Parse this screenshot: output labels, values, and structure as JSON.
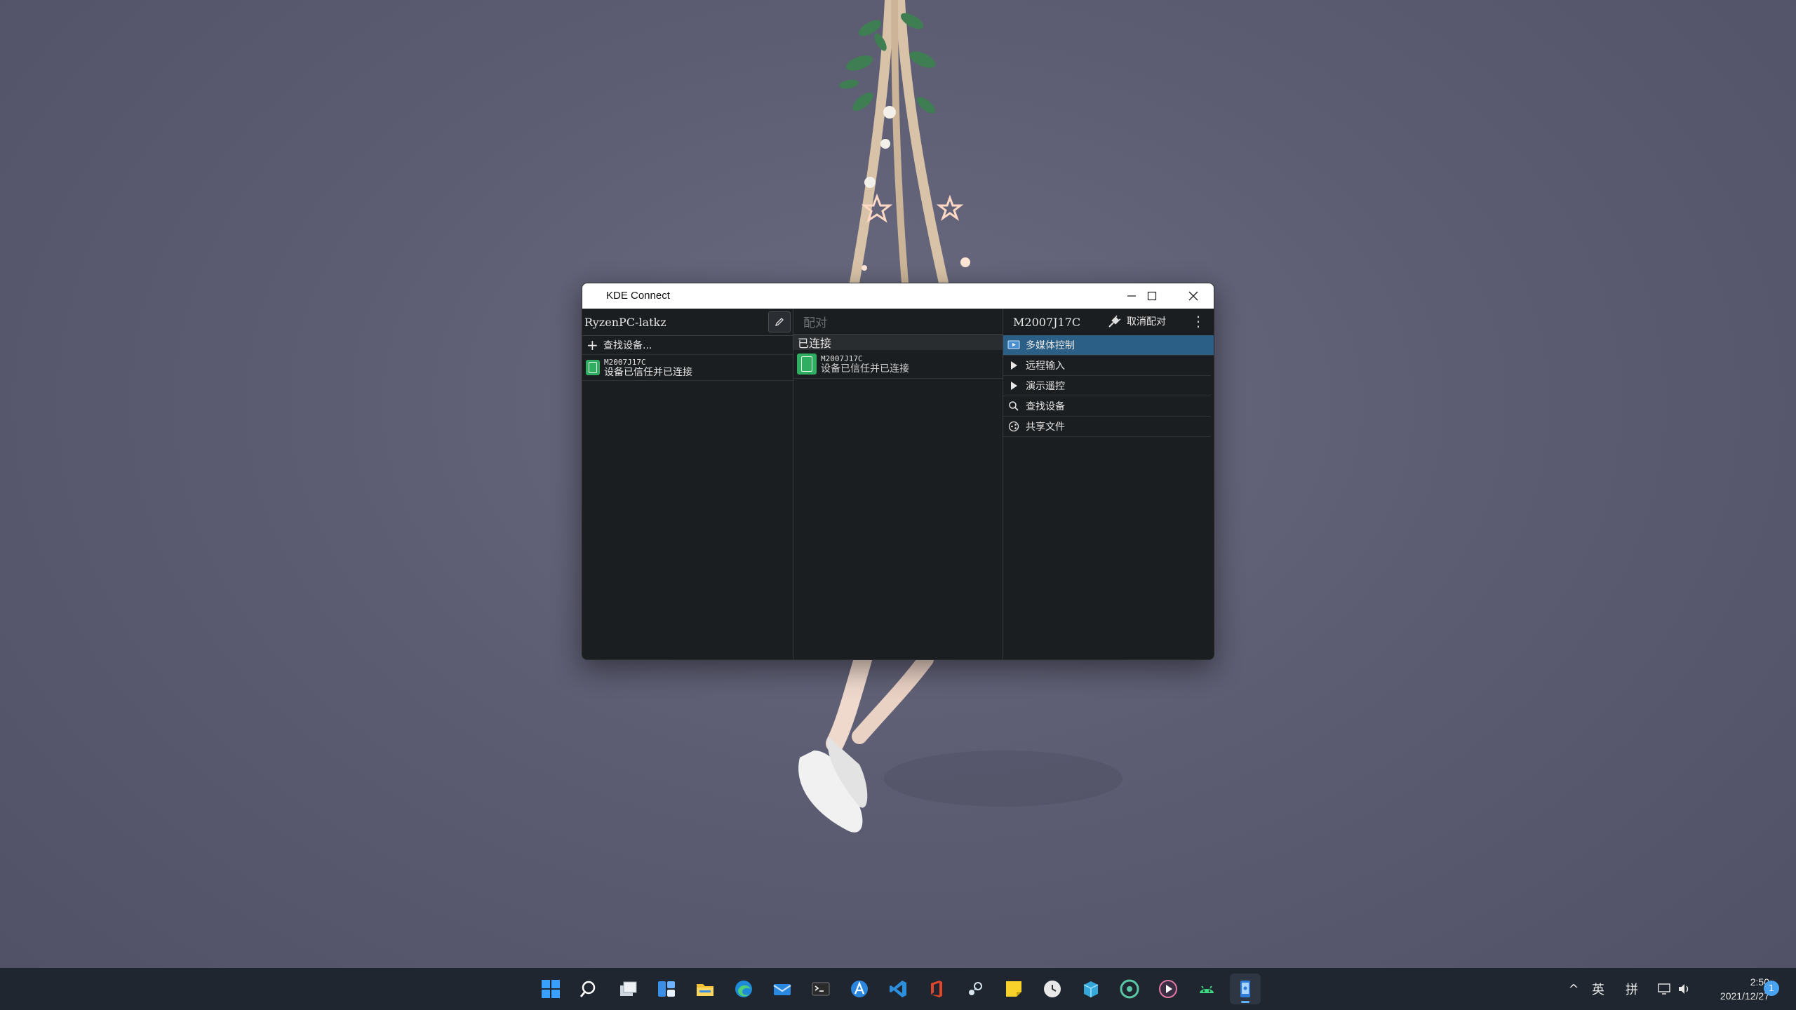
{
  "window": {
    "title": "KDE Connect",
    "controls": {
      "minimize": "minimize",
      "maximize": "maximize",
      "close": "close"
    }
  },
  "left_pane": {
    "host_name": "RyzenPC-latkz",
    "find_devices_label": "查找设备...",
    "devices": [
      {
        "name": "M2007J17C",
        "status": "设备已信任并已连接"
      }
    ]
  },
  "middle_pane": {
    "pair_label": "配对",
    "section_title": "已连接",
    "devices": [
      {
        "name": "M2007J17C",
        "status": "设备已信任并已连接"
      }
    ]
  },
  "right_pane": {
    "device_title": "M2007J17C",
    "unpair_label": "取消配对",
    "plugins": [
      {
        "label": "多媒体控制",
        "icon": "media-control-icon",
        "selected": true
      },
      {
        "label": "远程输入",
        "icon": "pointer-icon",
        "selected": false
      },
      {
        "label": "演示遥控",
        "icon": "pointer-icon",
        "selected": false
      },
      {
        "label": "查找设备",
        "icon": "search-icon",
        "selected": false
      },
      {
        "label": "共享文件",
        "icon": "share-icon",
        "selected": false
      }
    ]
  },
  "taskbar": {
    "apps": [
      "start-icon",
      "search-icon",
      "task-view-icon",
      "widgets-icon",
      "file-explorer-icon",
      "edge-icon",
      "mail-icon",
      "terminal-icon",
      "arc-icon",
      "vscode-icon",
      "office-icon",
      "steam-icon",
      "sticky-notes-icon",
      "clock-app-icon",
      "package-icon",
      "cd-icon",
      "media-player-icon",
      "android-icon",
      "kde-connect-icon"
    ],
    "tray": {
      "chevron": "^",
      "ime_lang": "英",
      "ime_mode": "拼"
    },
    "time": "2:50",
    "date": "2021/12/27",
    "notifications": "1"
  },
  "colors": {
    "accent": "#2b5f86",
    "device_green": "#2fae62",
    "window_bg": "#1b1e20",
    "taskbar_bg": "#1f2630"
  }
}
